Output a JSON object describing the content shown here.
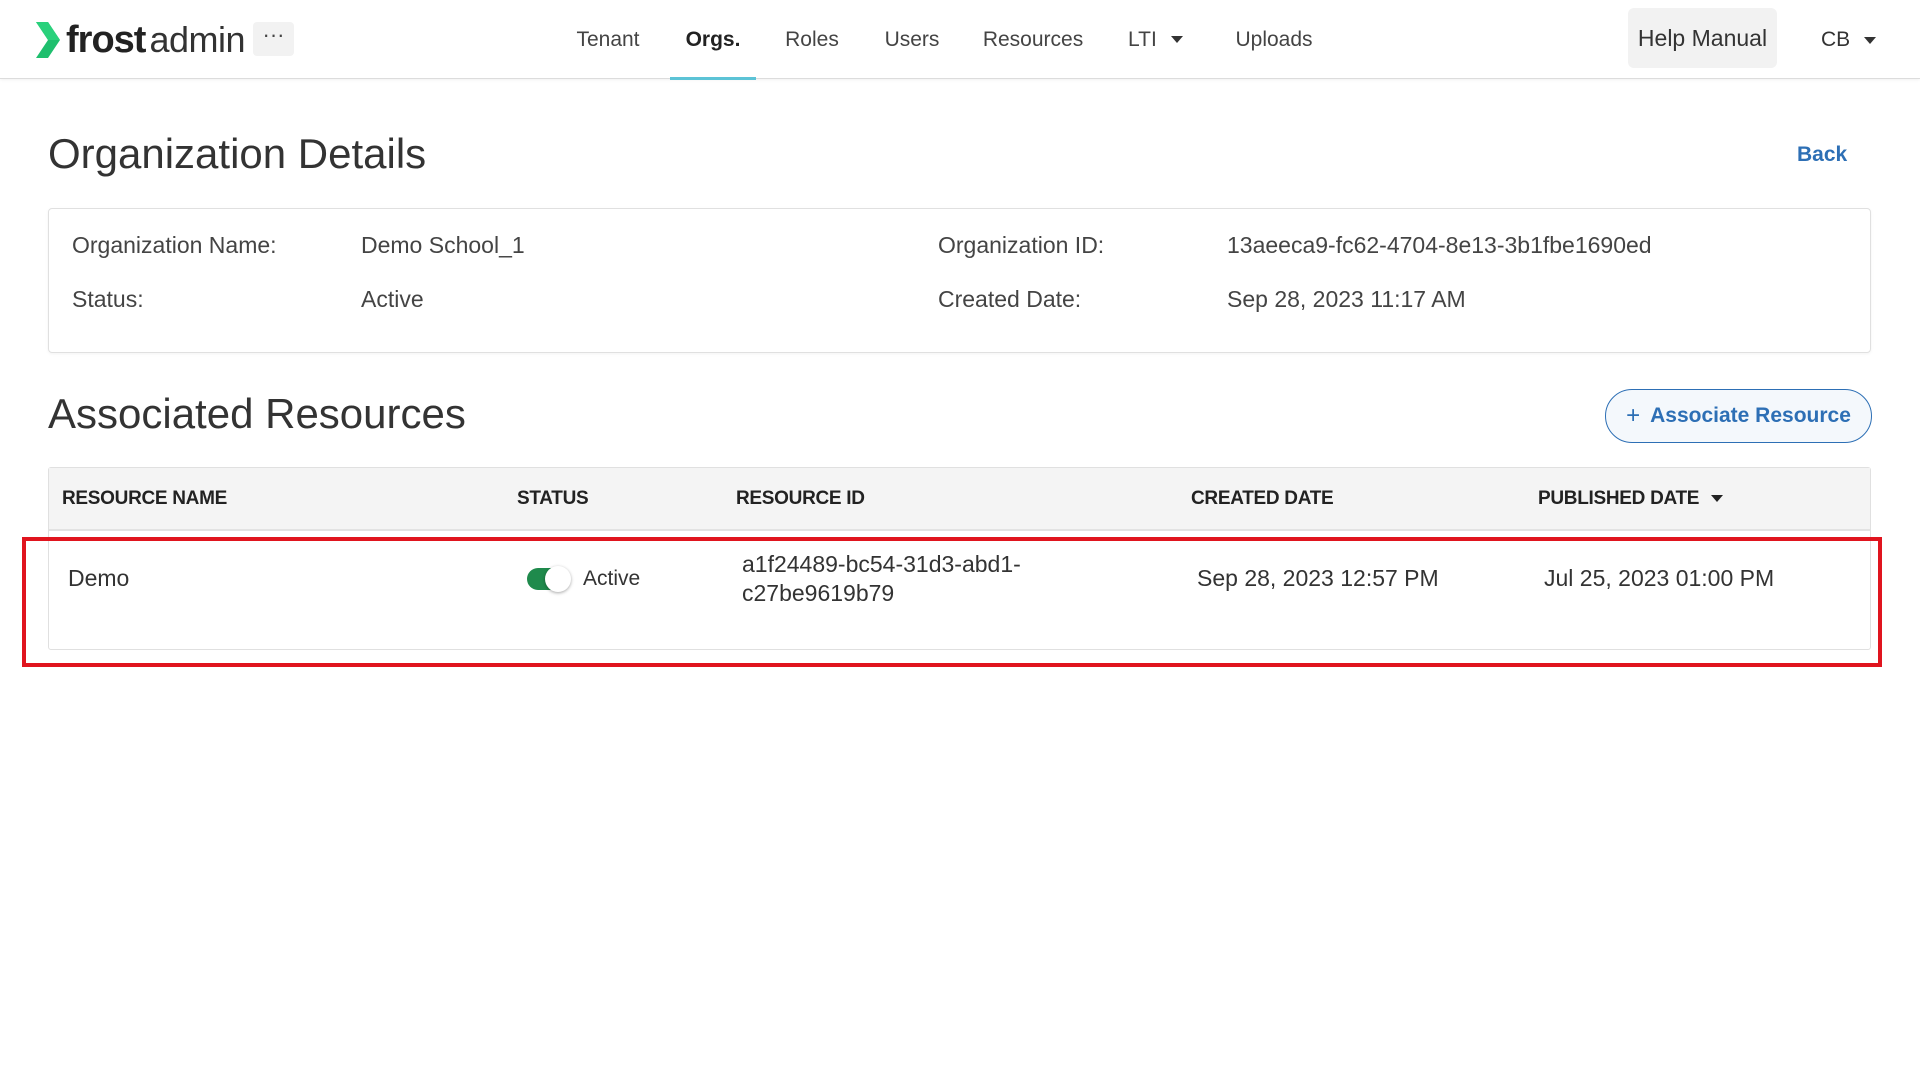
{
  "brand": {
    "name_bold": "frost",
    "name_light": "admin",
    "accent": "#1fbf6e"
  },
  "nav": {
    "more_label": "···",
    "items": [
      {
        "label": "Tenant"
      },
      {
        "label": "Orgs.",
        "active": true
      },
      {
        "label": "Roles"
      },
      {
        "label": "Users"
      },
      {
        "label": "Resources"
      },
      {
        "label": "LTI",
        "dropdown": true
      },
      {
        "label": "Uploads"
      }
    ],
    "help_label": "Help Manual",
    "user_initials": "CB"
  },
  "page": {
    "title": "Organization Details",
    "back_label": "Back"
  },
  "details": {
    "name_label": "Organization Name:",
    "name_value": "Demo School_1",
    "status_label": "Status:",
    "status_value": "Active",
    "id_label": "Organization ID:",
    "id_value": "13aeeca9-fc62-4704-8e13-3b1fbe1690ed",
    "created_label": "Created Date:",
    "created_value": "Sep 28, 2023 11:17 AM"
  },
  "resources": {
    "title": "Associated Resources",
    "associate_plus": "+",
    "associate_label": "Associate Resource",
    "columns": [
      "RESOURCE NAME",
      "STATUS",
      "RESOURCE ID",
      "CREATED DATE",
      "PUBLISHED DATE"
    ],
    "sorted_column": "PUBLISHED DATE",
    "rows": [
      {
        "name": "Demo",
        "status": "Active",
        "status_on": true,
        "id_line1": "a1f24489-bc54-31d3-abd1-",
        "id_line2": "c27be9619b79",
        "created": "Sep 28, 2023 12:57 PM",
        "published": "Jul 25, 2023 01:00 PM"
      }
    ]
  },
  "colors": {
    "link": "#2d6fb5",
    "active_tab": "#5cc3d6",
    "toggle_on": "#1f8a4c",
    "highlight": "#e0141e"
  }
}
